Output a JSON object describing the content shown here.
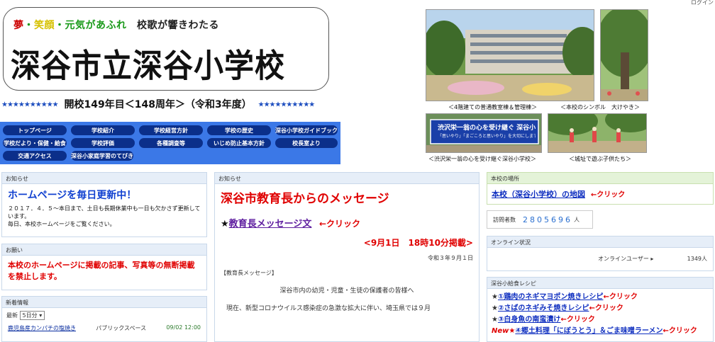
{
  "header": {
    "login": "ログイン",
    "slogan_1": "夢",
    "slogan_sep1": "・",
    "slogan_2": "笑顔",
    "slogan_sep2": "・",
    "slogan_3": "元気があふれ",
    "slogan_4": "校歌が響きわたる",
    "school_name": "深谷市立深谷小学校",
    "stars": "★★★★★★★★★★",
    "anniversary": "開校149年目＜148周年＞（令和3年度）"
  },
  "nav": {
    "items": [
      "トップページ",
      "学校紹介",
      "学校経営方針",
      "学校の歴史",
      "深谷小学校ガイドブック",
      "学校だより・保健・給食",
      "学校評価",
      "各種調査等",
      "いじめ防止基本方針",
      "校長室より",
      "交通アクセス",
      "深谷小家庭学習のてびき"
    ]
  },
  "photos": {
    "cap1": "＜4階建ての普通教室棟＆管理棟＞",
    "cap2": "＜本校のシンボル　大けやき＞",
    "cap3": "＜渋沢栄一翁の心を受け継ぐ深谷小学校＞",
    "cap4": "＜城址で遊ぶ子供たち＞",
    "sign_text": "渋沢栄一翁の心を受け継ぐ 深谷小学校",
    "sign_sub": "「思いやり」「まごころと思いやり」を大切にします"
  },
  "left": {
    "notice_head": "お知らせ",
    "notice_title": "ホームページを毎日更新中！",
    "notice_body1": "２０１７．４．５～本日まで、土日も長期休業中も一日も欠かさず更新しています。",
    "notice_body2": "毎日、本校ホームページをご覧ください。",
    "request_head": "お願い",
    "request_body": "本校のホームページに掲載の記事、写真等の無断掲載を禁止します。",
    "news_head": "新着情報",
    "latest_label": "最新",
    "latest_option": "5日分",
    "news_item_title": "鹿児島産カンパチの塩焼き",
    "news_item_space": "パブリックスペース",
    "news_item_time": "09/02 12:00"
  },
  "center": {
    "head": "お知らせ",
    "title": "深谷市教育長からのメッセージ",
    "star": "★",
    "link": "教育長メッセージ文",
    "click": "←クリック",
    "posted": "<9月1日　18時10分掲載>",
    "date": "令和３年９月１日",
    "label": "【教育長メッセージ】",
    "greeting": "深谷市内の幼児・児童・生徒の保護者の皆様へ",
    "body": "現在、新型コロナウイルス感染症の急激な拡大に伴い、埼玉県では９月"
  },
  "right": {
    "location_head": "本校の場所",
    "map_link": "本校（深谷小学校）の地図",
    "click": "←クリック",
    "visitors_label": "訪問者数",
    "visitors_digits": [
      "2",
      "8",
      "0",
      "5",
      "6",
      "9",
      "6"
    ],
    "visitors_unit": "人",
    "online_head": "オンライン状況",
    "online_label": "オンラインユーザー",
    "online_count": "1349人",
    "recipe_head": "深谷小給食レシピ",
    "recipes": [
      {
        "prefix": "★",
        "text": "①鶏肉のネギマヨポン焼きレシピ",
        "click": "←クリック"
      },
      {
        "prefix": "★",
        "text": "②さばのネギみそ焼きレシピ",
        "click": "←クリック"
      },
      {
        "prefix": "★",
        "text": "③白身魚の南蛮漬け",
        "click": "←クリック"
      },
      {
        "prefix": "New★",
        "text": "④郷土料理「にぼうとう」＆ごま味噌ラーメン",
        "click": "←クリック"
      }
    ]
  },
  "colors": {
    "nav_bg": "#3b78e7",
    "nav_btn": "#0b2f8a",
    "accent_red": "#e00000",
    "link_blue": "#1030c0"
  }
}
